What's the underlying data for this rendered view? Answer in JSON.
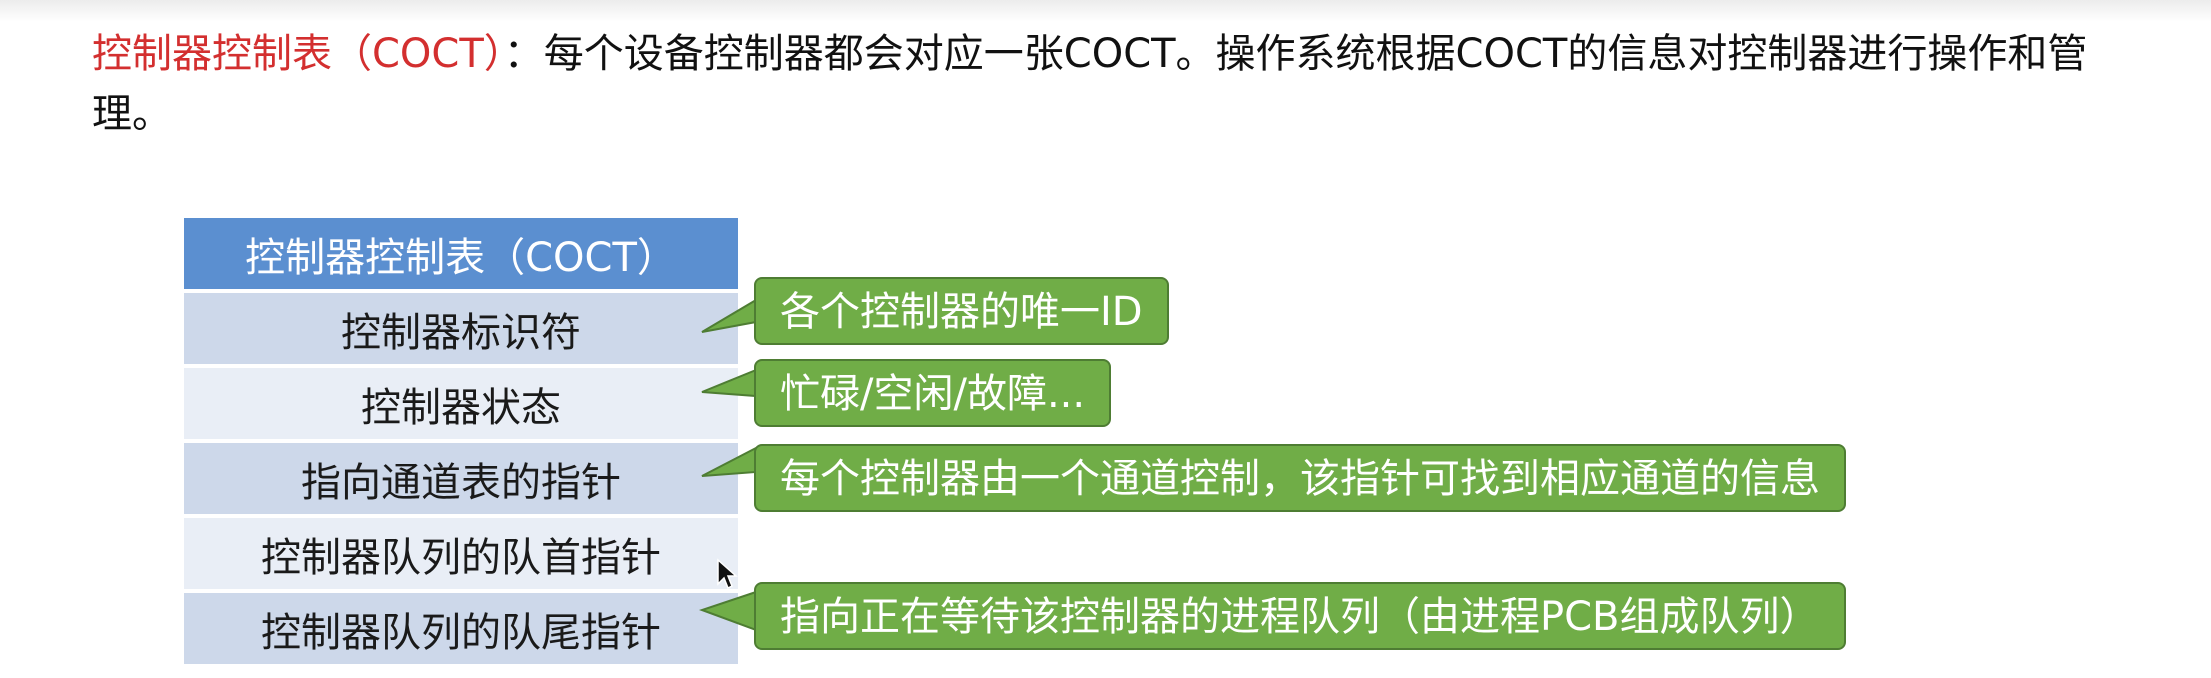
{
  "intro": {
    "term": "控制器控制表（COCT）",
    "text": "：每个设备控制器都会对应一张COCT。操作系统根据COCT的信息对控制器进行操作和管理。"
  },
  "table": {
    "header": "控制器控制表（COCT）",
    "rows": [
      "控制器标识符",
      "控制器状态",
      "指向通道表的指针",
      "控制器队列的队首指针",
      "控制器队列的队尾指针"
    ]
  },
  "callouts": [
    "各个控制器的唯一ID",
    "忙碌/空闲/故障...",
    "每个控制器由一个通道控制，该指针可找到相应通道的信息",
    "指向正在等待该控制器的进程队列（由进程PCB组成队列）"
  ],
  "colors": {
    "term": "#d32f2f",
    "header_bg": "#5b8fd0",
    "row_dark": "#cdd8ea",
    "row_light": "#e9eef6",
    "callout_bg": "#70ad47",
    "callout_border": "#4e7d33"
  }
}
